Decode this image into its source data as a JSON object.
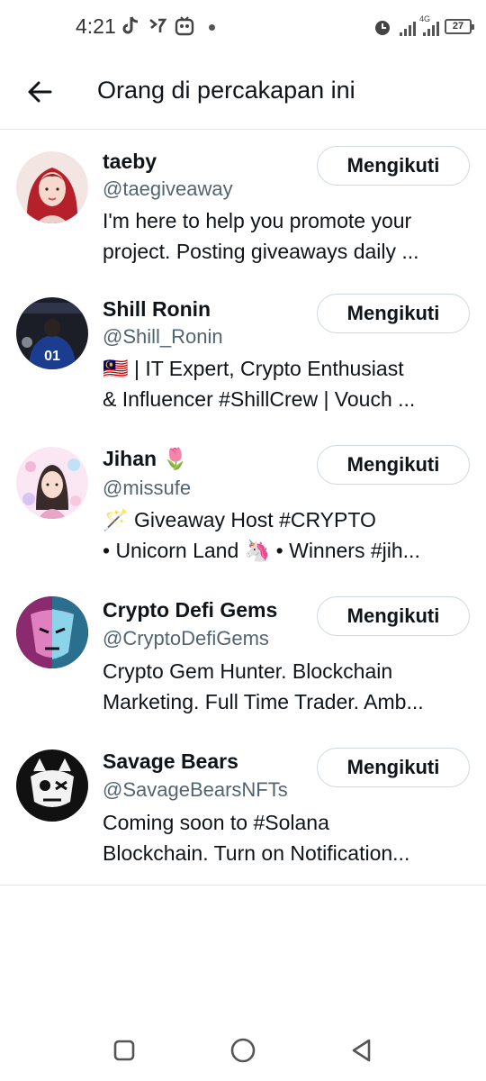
{
  "status_bar": {
    "time": "4:21",
    "network": "4G",
    "battery": "27",
    "icons": [
      "tiktok-icon",
      "app-notification-icon",
      "face-icon",
      "alarm-icon",
      "signal-icon",
      "signal-icon",
      "battery-icon"
    ]
  },
  "header": {
    "title": "Orang di percakapan ini",
    "back_icon": "arrow-left-icon"
  },
  "users": [
    {
      "name": "taeby",
      "handle": "@taegiveaway",
      "bio_line1": "I'm here to help you promote your",
      "bio_line2": "project. Posting giveaways daily ...",
      "follow_label": "Mengikuti"
    },
    {
      "name": "Shill Ronin",
      "handle": "@Shill_Ronin",
      "bio_line1": "🇲🇾 | IT Expert, Crypto Enthusiast",
      "bio_line2": "& Influencer #ShillCrew | Vouch ...",
      "follow_label": "Mengikuti"
    },
    {
      "name": "Jihan 🌷",
      "handle": "@missufe",
      "bio_line1": "🪄 Giveaway Host #CRYPTO",
      "bio_line2": "• Unicorn Land 🦄 • Winners #jih...",
      "follow_label": "Mengikuti"
    },
    {
      "name": "Crypto Defi Gems",
      "handle": "@CryptoDefiGems",
      "bio_line1": "Crypto Gem Hunter. Blockchain",
      "bio_line2": "Marketing. Full Time Trader. Amb...",
      "follow_label": "Mengikuti"
    },
    {
      "name": "Savage Bears",
      "handle": "@SavageBearsNFTs",
      "bio_line1": "Coming soon to #Solana",
      "bio_line2": "Blockchain. Turn on Notification...",
      "follow_label": "Mengikuti"
    }
  ],
  "avatar_jersey_number": "01",
  "nav_bar": {
    "icons": [
      "recents-icon",
      "home-icon",
      "back-icon"
    ]
  },
  "colors": {
    "text_primary": "#0f1419",
    "text_secondary": "#536471",
    "border": "#cfd9de"
  }
}
